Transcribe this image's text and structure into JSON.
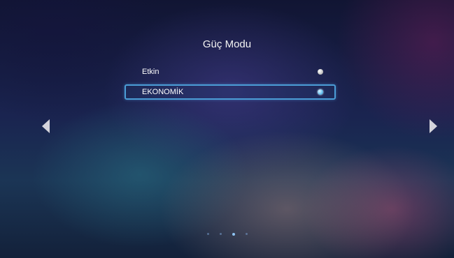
{
  "title": "Güç Modu",
  "options": [
    {
      "label": "Etkin",
      "selected": false
    },
    {
      "label": "EKONOMİK",
      "selected": true
    }
  ],
  "navigation": {
    "left_icon": "triangle-left",
    "right_icon": "triangle-right"
  },
  "pager": {
    "count": 4,
    "active_index": 2
  },
  "colors": {
    "highlight_border": "#4b9dd6",
    "radio_selected": "#6cc3f0",
    "radio_unselected": "#c8c8c8"
  }
}
